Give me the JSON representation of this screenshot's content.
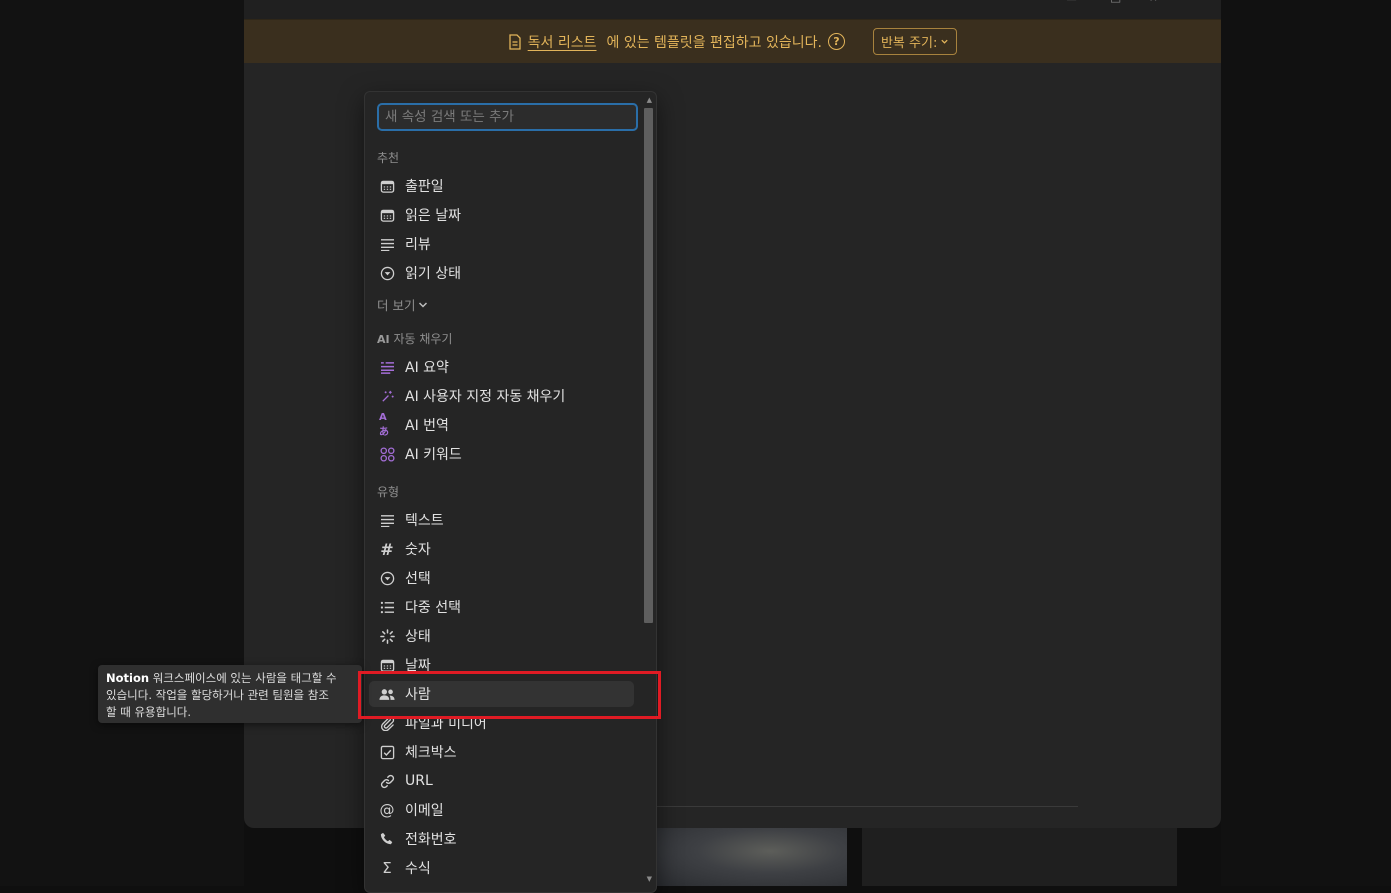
{
  "banner": {
    "doc_link": "독서 리스트",
    "message": "에 있는 템플릿을 편집하고 있습니다.",
    "help_symbol": "?",
    "repeat_label": "반복 주기:",
    "colors": {
      "background": "#3a2f1e",
      "text": "#e2b45a"
    }
  },
  "menu": {
    "search": {
      "placeholder": "새 속성 검색 또는 추가"
    },
    "sections": {
      "suggested": "추천",
      "ai_prefix": "AI",
      "ai": "자동 채우기",
      "types": "유형"
    },
    "suggested_items": [
      {
        "label": "출판일",
        "icon": "calendar-icon"
      },
      {
        "label": "읽은 날짜",
        "icon": "calendar-icon"
      },
      {
        "label": "리뷰",
        "icon": "text-lines-icon"
      },
      {
        "label": "읽기 상태",
        "icon": "select-icon"
      }
    ],
    "more_label": "더 보기",
    "ai_items": [
      {
        "label": "AI 요약",
        "icon": "ai-summary-icon"
      },
      {
        "label": "AI 사용자 지정 자동 채우기",
        "icon": "ai-sparkle-icon"
      },
      {
        "label": "AI 번역",
        "icon": "ai-translate-icon"
      },
      {
        "label": "AI 키워드",
        "icon": "ai-keywords-icon"
      }
    ],
    "ai_icon_glyphs": {
      "translate": "Aあ"
    },
    "type_items": [
      {
        "label": "텍스트",
        "icon": "text-lines-icon"
      },
      {
        "label": "숫자",
        "icon": "hash-icon"
      },
      {
        "label": "선택",
        "icon": "select-icon"
      },
      {
        "label": "다중 선택",
        "icon": "list-icon"
      },
      {
        "label": "상태",
        "icon": "status-icon"
      },
      {
        "label": "날짜",
        "icon": "calendar-icon"
      },
      {
        "label": "사람",
        "icon": "people-icon",
        "hovered": true
      },
      {
        "label": "파일과 미디어",
        "icon": "paperclip-icon"
      },
      {
        "label": "체크박스",
        "icon": "checkbox-icon"
      },
      {
        "label": "URL",
        "icon": "link-icon"
      },
      {
        "label": "이메일",
        "icon": "at-icon"
      },
      {
        "label": "전화번호",
        "icon": "phone-icon"
      },
      {
        "label": "수식",
        "icon": "sigma-icon"
      }
    ],
    "glyphs": {
      "hash": "#",
      "at": "@",
      "sigma": "Σ"
    }
  },
  "tooltip": {
    "brand": "Notion",
    "line1": "워크스페이스에 있는 사람을 태그할 수",
    "line2": "있습니다. 작업을 할당하거나 관련 팀원을 참조",
    "line3": "할 때 유용합니다."
  },
  "highlight_color": "#e01b24"
}
